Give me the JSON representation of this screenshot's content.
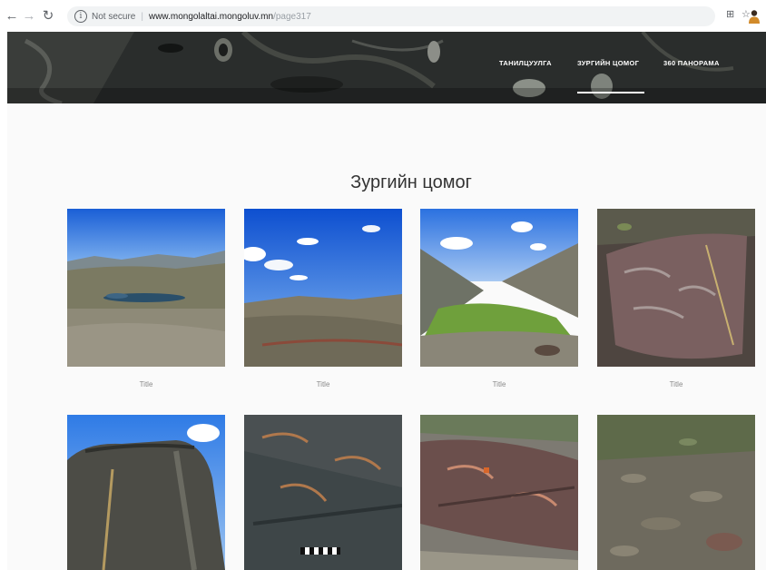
{
  "browser": {
    "security": "Not secure",
    "url_host": "www.mongolaltai.mongoluv.mn",
    "url_path": "/page317"
  },
  "site": {
    "menu": [
      "ТАНИЛЦУУЛГА",
      "ЗУРГИЙН ЦОМОГ",
      "360 ПАНОРАМА"
    ],
    "active_menu": "ЗУРГИЙН ЦОМОГ"
  },
  "gallery": {
    "heading": "Зургийн цомог",
    "row1": [
      {
        "caption": "Title",
        "scene": "mountain lake valley"
      },
      {
        "caption": "Title",
        "scene": "blue sky over valley"
      },
      {
        "caption": "Title",
        "scene": "green river valley"
      },
      {
        "caption": "Title",
        "scene": "petroglyph rock"
      }
    ],
    "row2": [
      {
        "scene": "rock with petroglyphs under sky"
      },
      {
        "scene": "dark petroglyph rock with scale bar"
      },
      {
        "scene": "reddish petroglyph rock"
      },
      {
        "scene": "rocky grassy slope"
      }
    ]
  }
}
